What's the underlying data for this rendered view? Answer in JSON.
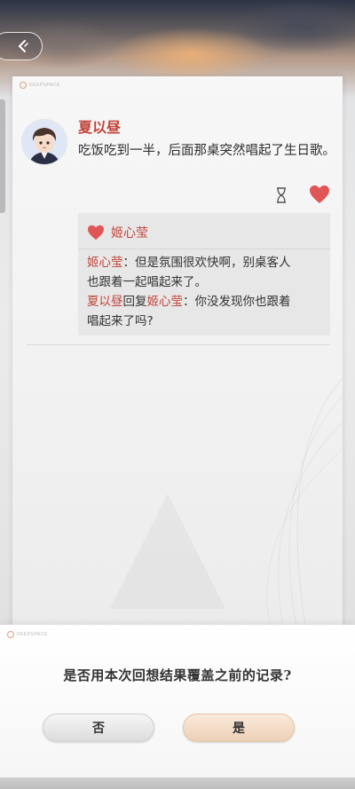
{
  "brand_text": "DEEPSPACE",
  "post": {
    "author": "夏以昼",
    "content": "吃饭吃到一半，后面那桌突然唱起了生日歌。"
  },
  "likes": {
    "likers": "姬心莹"
  },
  "comments": [
    {
      "author": "姬心莹",
      "separator": "：",
      "text": "但是氛围很欢快啊，别桌客人"
    },
    {
      "continuation": "也跟着一起唱起来了。"
    },
    {
      "author": "夏以昼",
      "reply_word": "回复",
      "reply_to": "姬心莹",
      "separator": "：",
      "text": "你没发现你也跟着"
    },
    {
      "continuation": "唱起来了吗?"
    }
  ],
  "dialog": {
    "question": "是否用本次回想结果覆盖之前的记录?",
    "no_label": "否",
    "yes_label": "是"
  },
  "colors": {
    "accent_red": "#c2443a",
    "heart": "#e05555",
    "yes_button": "#ecd0b6"
  },
  "icons": [
    "back-arrow-icon",
    "hourglass-icon",
    "heart-icon"
  ]
}
